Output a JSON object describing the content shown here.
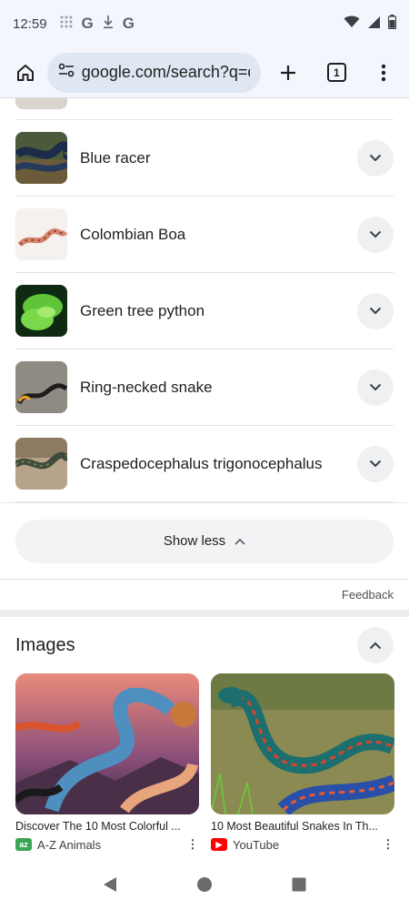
{
  "status_bar": {
    "time": "12:59",
    "icons": [
      "grid-icon",
      "google-g-icon",
      "download-icon",
      "google-g-icon",
      "wifi-icon",
      "signal-icon",
      "battery-icon"
    ],
    "g": "G"
  },
  "toolbar": {
    "url": "google.com/search?q=d",
    "tab_count": "1",
    "icons": [
      "home-icon",
      "site-settings-icon",
      "new-tab-icon",
      "more-vert-icon"
    ]
  },
  "snakes": [
    {
      "name": "Blue racer"
    },
    {
      "name": "Colombian Boa"
    },
    {
      "name": "Green tree python"
    },
    {
      "name": "Ring-necked snake"
    },
    {
      "name": "Craspedocephalus trigonocephalus"
    }
  ],
  "show_less_label": "Show less",
  "feedback_label": "Feedback",
  "images_section": {
    "title": "Images",
    "items": [
      {
        "title": "Discover The 10 Most Colorful ...",
        "source": "A-Z Animals",
        "source_icon": "a-z-animals-icon"
      },
      {
        "title": "10 Most Beautiful Snakes In Th...",
        "source": "YouTube",
        "source_icon": "youtube-icon"
      }
    ]
  },
  "colors": {
    "accent": "#1a73e8",
    "chip_bg": "#eef0f2",
    "toolbar_bg": "#f3f6fc",
    "youtube_red": "#ff0000",
    "az_green": "#3aa655"
  }
}
